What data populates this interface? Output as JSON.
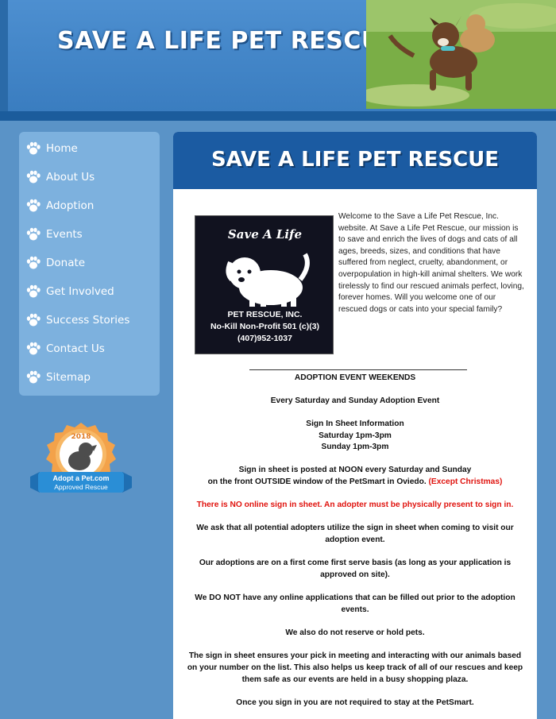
{
  "header": {
    "site_title": "SAVE A LIFE PET RESCUE"
  },
  "nav": {
    "items": [
      {
        "label": "Home"
      },
      {
        "label": "About Us"
      },
      {
        "label": "Adoption"
      },
      {
        "label": "Events"
      },
      {
        "label": "Donate"
      },
      {
        "label": "Get Involved"
      },
      {
        "label": "Success Stories"
      },
      {
        "label": "Contact Us"
      },
      {
        "label": "Sitemap"
      }
    ]
  },
  "badge": {
    "year": "2018",
    "brand": "Adopt a Pet.com",
    "caption": "Approved Rescue"
  },
  "main": {
    "title": "SAVE A LIFE PET RESCUE",
    "logo": {
      "line1": "Save A Life",
      "line2": "PET RESCUE, INC.",
      "line3": "No-Kill Non-Profit 501 (c)(3)",
      "line4": "(407)952-1037"
    },
    "intro": "Welcome to the Save a Life Pet Rescue, Inc. website. At Save a Life Pet Rescue, our mission is to save and enrich the lives of dogs and cats of all ages, breeds, sizes, and conditions that have suffered from neglect, cruelty, abandonment, or overpopulation in high-kill animal shelters. We work tirelessly to find our rescued animals perfect, loving, forever homes. Will you welcome one of our rescued dogs or cats into your special family?",
    "events_heading": "ADOPTION EVENT WEEKENDS",
    "every_weekend": "Every Saturday and Sunday Adoption Event",
    "signin_heading": "Sign In Sheet Information",
    "saturday": "Saturday 1pm-3pm",
    "sunday": "Sunday 1pm-3pm",
    "posted_line1": "Sign in sheet is posted at NOON every Saturday and Sunday",
    "posted_line2": "on the front OUTSIDE window of the PetSmart in Oviedo.",
    "except": "(Except Christmas)",
    "no_online": "There is NO online sign in sheet. An adopter must be physically present to sign in.",
    "ask_line1": "We ask that all potential adopters utilize the sign in sheet when coming to visit our",
    "ask_line2": "adoption event.",
    "first_line1": "Our adoptions are on a first come first serve basis (as long as your application is",
    "first_line2": "approved on site).",
    "noapp_line1": "We DO NOT have any online applications that can be filled out prior to the adoption",
    "noapp_line2": "events.",
    "reserve": "We also do not reserve or hold pets.",
    "ensures_line1": "The sign in sheet ensures your pick in meeting and interacting with our animals based",
    "ensures_line2": "on your number on the list. This also helps us keep track of all of our rescues and keep",
    "ensures_line3": "them safe as our events are held in a busy shopping plaza.",
    "once": "Once you sign in you are not required to stay at the PetSmart."
  }
}
